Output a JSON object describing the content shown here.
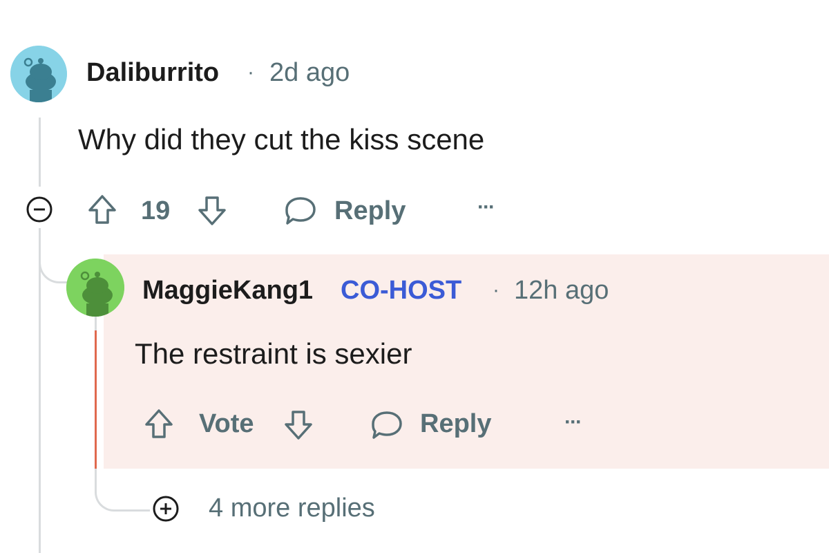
{
  "comment": {
    "author": "Daliburrito",
    "separator": "·",
    "time": "2d ago",
    "body": "Why did they cut the kiss scene",
    "score": "19",
    "reply_label": "Reply",
    "more_label": "···",
    "avatar_color": "#87d3e7"
  },
  "reply": {
    "author": "MaggieKang1",
    "badge": "CO-HOST",
    "separator": "·",
    "time": "12h ago",
    "body": "The restraint is sexier",
    "vote_label": "Vote",
    "reply_label": "Reply",
    "more_label": "···",
    "avatar_color": "#7dd35f",
    "highlight_color": "#fbeeeb",
    "accent_color": "#e0694e"
  },
  "more_replies": {
    "label": "4 more replies"
  }
}
